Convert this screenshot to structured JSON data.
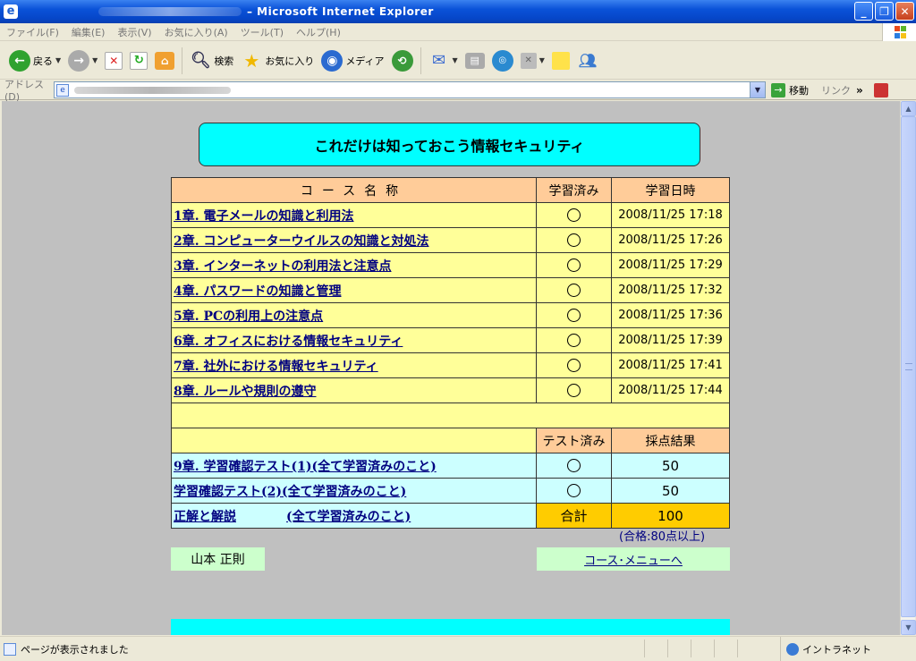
{
  "window": {
    "title": "– Microsoft Internet Explorer",
    "buttons": [
      "minimize",
      "maximize",
      "close"
    ]
  },
  "menubar": {
    "items": [
      "ファイル(F)",
      "編集(E)",
      "表示(V)",
      "お気に入り(A)",
      "ツール(T)",
      "ヘルプ(H)"
    ]
  },
  "toolbar": {
    "back": "戻る",
    "search": "検索",
    "favorites": "お気に入り",
    "media": "メディア"
  },
  "address": {
    "label": "アドレス(D)",
    "go": "移動",
    "links": "リンク",
    "links_more": "»"
  },
  "page": {
    "heading": "これだけは知っておこう情報セキュリティ",
    "headers": {
      "course": "コース名称",
      "done": "学習済み",
      "date": "学習日時",
      "test_done": "テスト済み",
      "result": "採点結果"
    },
    "chapters": [
      {
        "name": "1章. 電子メールの知識と利用法",
        "date": "2008/11/25 17:18"
      },
      {
        "name": "2章. コンピューターウイルスの知識と対処法",
        "date": "2008/11/25 17:26"
      },
      {
        "name": "3章. インターネットの利用法と注意点",
        "date": "2008/11/25 17:29"
      },
      {
        "name": "4章. パスワードの知識と管理",
        "date": "2008/11/25 17:32"
      },
      {
        "name": "5章. PCの利用上の注意点",
        "date": "2008/11/25 17:36"
      },
      {
        "name": "6章. オフィスにおける情報セキュリティ",
        "date": "2008/11/25 17:39"
      },
      {
        "name": "7章. 社外における情報セキュリティ",
        "date": "2008/11/25 17:41"
      },
      {
        "name": "8章. ルールや規則の遵守",
        "date": "2008/11/25 17:44"
      }
    ],
    "tests": [
      {
        "name": "9章. 学習確認テスト(1)(全て学習済みのこと)",
        "score": "50"
      },
      {
        "name": "学習確認テスト(2)(全て学習済みのこと)",
        "score": "50"
      }
    ],
    "solution": {
      "label": "正解と解説",
      "note": "(全て学習済みのこと)"
    },
    "total_label": "合計",
    "total": "100",
    "pass_note": "(合格:80点以上)",
    "user_name": "山本 正則",
    "menu_link": "コース･メニューへ"
  },
  "status": {
    "text": "ページが表示されました",
    "zone": "イントラネット"
  }
}
